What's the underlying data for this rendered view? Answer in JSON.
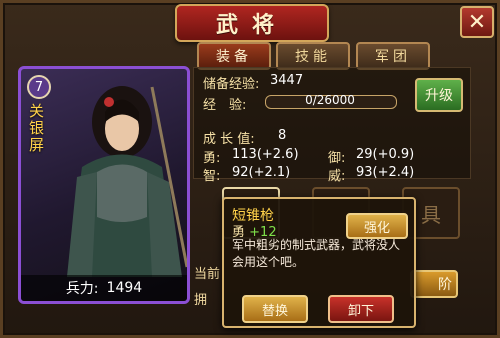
{
  "title": "武将",
  "close_label": "✕",
  "tabs": [
    {
      "label": "装备",
      "active": true
    },
    {
      "label": "技能",
      "active": false
    },
    {
      "label": "军团",
      "active": false
    }
  ],
  "hero": {
    "level": "7",
    "name": "关银屏",
    "troops_label": "兵力:",
    "troops_value": "1494"
  },
  "info": {
    "reserve_exp_label": "储备经验:",
    "reserve_exp_value": "3447",
    "exp_label": "经　验:",
    "exp_progress": "0/26000",
    "exp_fraction": 0.0,
    "upgrade_label": "升级",
    "growth_label": "成 长 值:",
    "growth_value": "8",
    "brave_label": "勇:",
    "brave_value": "113(+2.6)",
    "defense_label": "御:",
    "defense_value": "29(+0.9)",
    "wisdom_label": "智:",
    "wisdom_value": "92(+2.1)",
    "might_label": "威:",
    "might_value": "93(+2.4)"
  },
  "bottom": {
    "line1": "当前",
    "line2": "拥",
    "advance_label": "阶",
    "slot_glyph": "具"
  },
  "tooltip": {
    "name": "短锥枪",
    "stat_label": "勇",
    "stat_value": "+12",
    "description": "军中粗劣的制式武器，武将没人会用这个吧。",
    "strengthen_label": "强化",
    "swap_label": "替换",
    "unequip_label": "卸下"
  },
  "colors": {
    "banner_red": "#b02620",
    "card_border_purple": "#8b4fd4",
    "upgrade_green": "#3f8f32",
    "gold_button": "#c8912e",
    "unequip_red": "#a8241c"
  }
}
